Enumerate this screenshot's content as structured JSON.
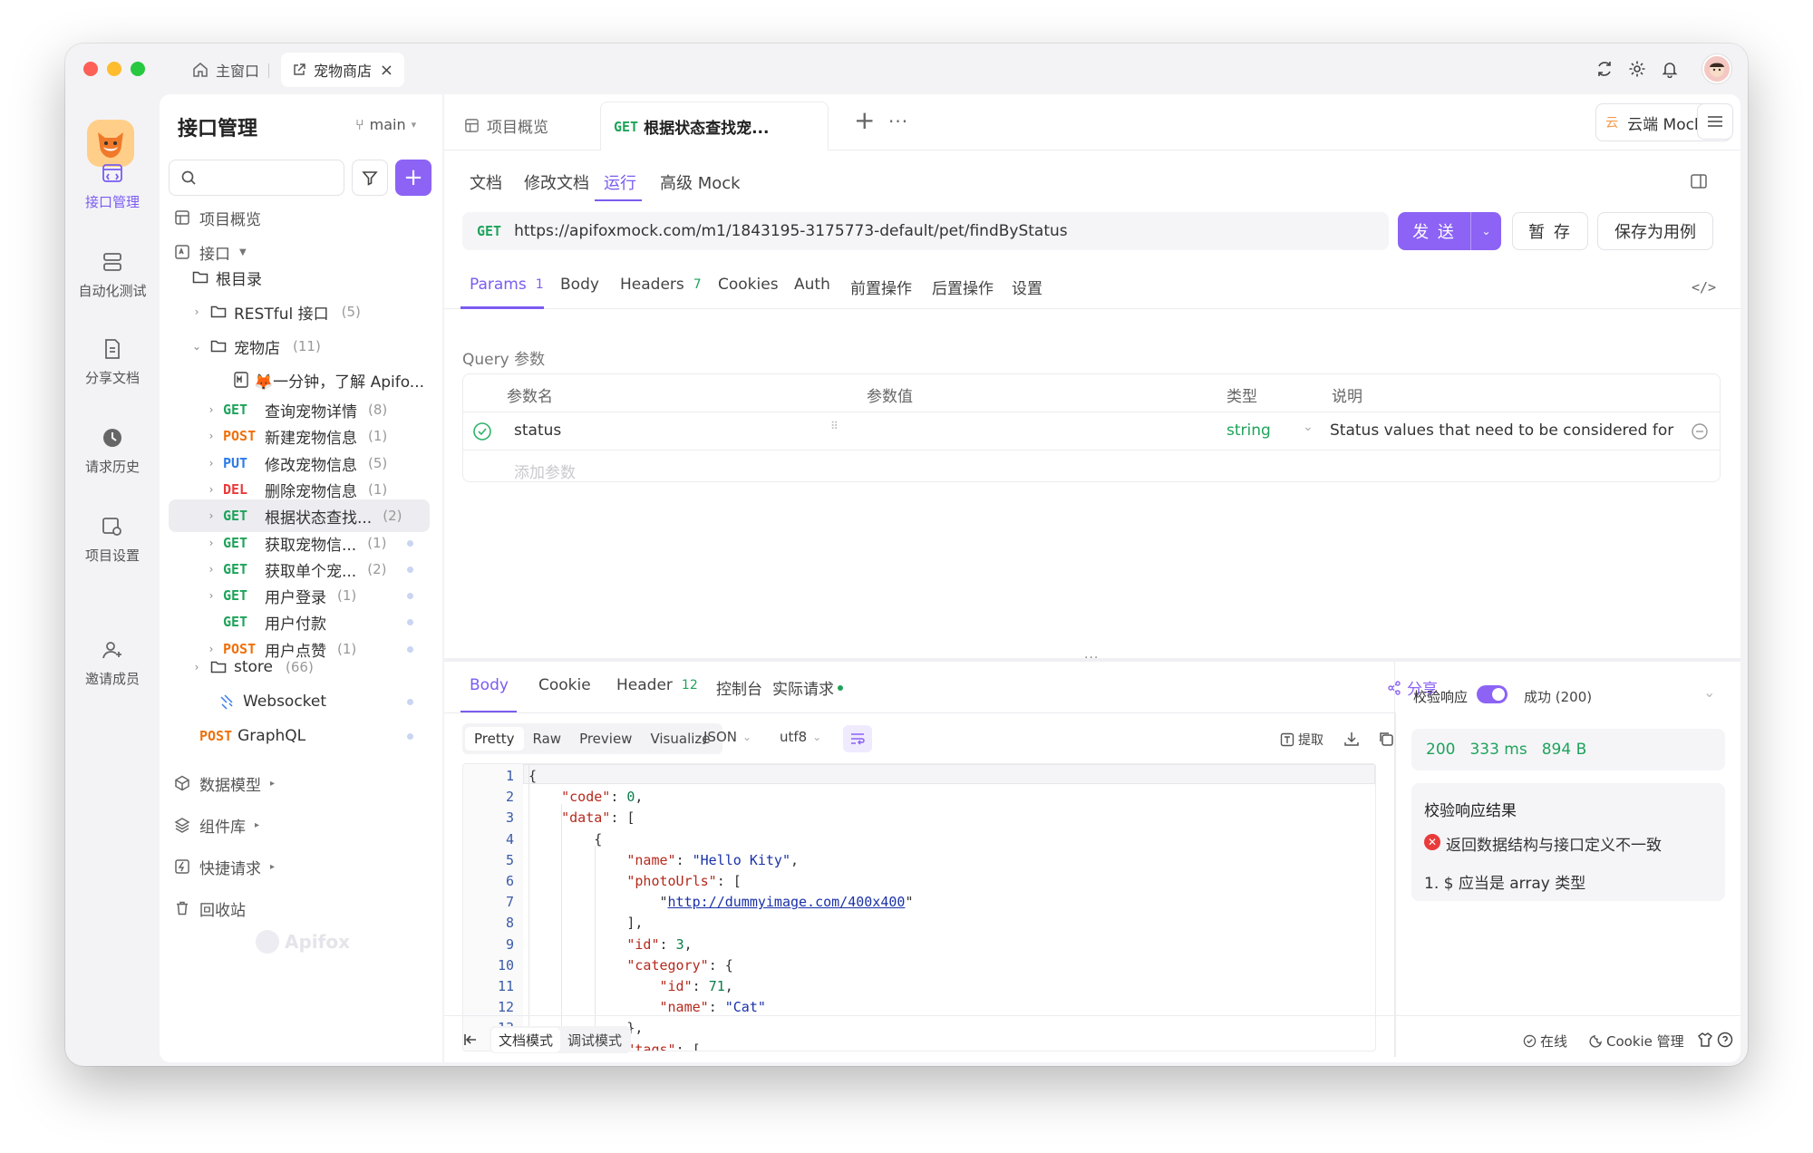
{
  "titlebar": {
    "home_tab": "主窗口",
    "project_tab": "宠物商店",
    "close": "×"
  },
  "rail": [
    {
      "label": "接口管理",
      "active": true,
      "icon": "api-icon"
    },
    {
      "label": "自动化测试",
      "icon": "automation-icon"
    },
    {
      "label": "分享文档",
      "icon": "share-doc-icon"
    },
    {
      "label": "请求历史",
      "icon": "history-icon"
    },
    {
      "label": "项目设置",
      "icon": "settings-icon"
    },
    {
      "label": "邀请成员",
      "icon": "invite-icon"
    }
  ],
  "sidebar": {
    "title": "接口管理",
    "branch": "main",
    "search_placeholder": "",
    "overview": "项目概览",
    "api_section": "接口",
    "root": "根目录",
    "restful": {
      "name": "RESTful 接口",
      "count": "(5)"
    },
    "petshop": {
      "name": "宠物店",
      "count": "(11)"
    },
    "doc_item": "🦊一分钟，了解 Apifo...",
    "items": [
      {
        "method": "GET",
        "name": "查询宠物详情",
        "count": "(8)"
      },
      {
        "method": "POST",
        "name": "新建宠物信息",
        "count": "(1)"
      },
      {
        "method": "PUT",
        "name": "修改宠物信息",
        "count": "(5)"
      },
      {
        "method": "DEL",
        "name": "删除宠物信息",
        "count": "(1)"
      },
      {
        "method": "GET",
        "name": "根据状态查找...",
        "count": "(2)"
      },
      {
        "method": "GET",
        "name": "获取宠物信...",
        "count": "(1)"
      },
      {
        "method": "GET",
        "name": "获取单个宠...",
        "count": "(2)"
      },
      {
        "method": "GET",
        "name": "用户登录",
        "count": "(1)"
      },
      {
        "method": "GET",
        "name": "用户付款",
        "count": ""
      },
      {
        "method": "POST",
        "name": "用户点赞",
        "count": "(1)"
      }
    ],
    "store": {
      "name": "store",
      "count": "(66)"
    },
    "websocket": "Websocket",
    "graphql": {
      "method": "POST",
      "name": "GraphQL"
    },
    "models": "数据模型",
    "components": "组件库",
    "quick": "快捷请求",
    "trash": "回收站",
    "watermark": "Apifox"
  },
  "tabs": {
    "overview": "项目概览",
    "active_method": "GET",
    "active_name": "根据状态查找宠...",
    "add": "+",
    "more": "···",
    "env": "云端 Mock"
  },
  "subtabs": [
    "文档",
    "修改文档",
    "运行",
    "高级 Mock"
  ],
  "request": {
    "method": "GET",
    "url": "https://apifoxmock.com/m1/1843195-3175773-default/pet/findByStatus",
    "send": "发 送",
    "save_temp": "暂 存",
    "save_case": "保存为用例"
  },
  "req_tabs": [
    {
      "label": "Params",
      "badge": "1"
    },
    {
      "label": "Body"
    },
    {
      "label": "Headers",
      "badge": "7"
    },
    {
      "label": "Cookies"
    },
    {
      "label": "Auth"
    },
    {
      "label": "前置操作"
    },
    {
      "label": "后置操作"
    },
    {
      "label": "设置"
    }
  ],
  "query": {
    "title": "Query 参数",
    "cols": [
      "参数名",
      "参数值",
      "类型",
      "说明"
    ],
    "row": {
      "name": "status",
      "value": "",
      "type": "string",
      "desc": "Status values that need to be considered for f"
    },
    "add": "添加参数"
  },
  "resp_tabs": [
    {
      "label": "Body"
    },
    {
      "label": "Cookie"
    },
    {
      "label": "Header",
      "badge": "12"
    },
    {
      "label": "控制台"
    },
    {
      "label": "实际请求"
    }
  ],
  "share": "分享",
  "view_modes": [
    "Pretty",
    "Raw",
    "Preview",
    "Visualize"
  ],
  "format": "JSON",
  "encoding": "utf8",
  "extract": "提取",
  "code": [
    "{",
    "    \"code\": 0,",
    "    \"data\": [",
    "        {",
    "            \"name\": \"Hello Kity\",",
    "            \"photoUrls\": [",
    "                \"http://dummyimage.com/400x400\"",
    "            ],",
    "            \"id\": 3,",
    "            \"category\": {",
    "                \"id\": 71,",
    "                \"name\": \"Cat\"",
    "            },",
    "            \"tags\": ["
  ],
  "validate": {
    "label": "校验响应",
    "status": "成功 (200)",
    "code": "200",
    "time": "333 ms",
    "size": "894 B",
    "result_title": "校验响应结果",
    "error": "返回数据结构与接口定义不一致",
    "detail": "1. $ 应当是 array 类型"
  },
  "footer": {
    "doc_mode": "文档模式",
    "debug_mode": "调试模式",
    "online": "在线",
    "cookie": "Cookie 管理"
  }
}
